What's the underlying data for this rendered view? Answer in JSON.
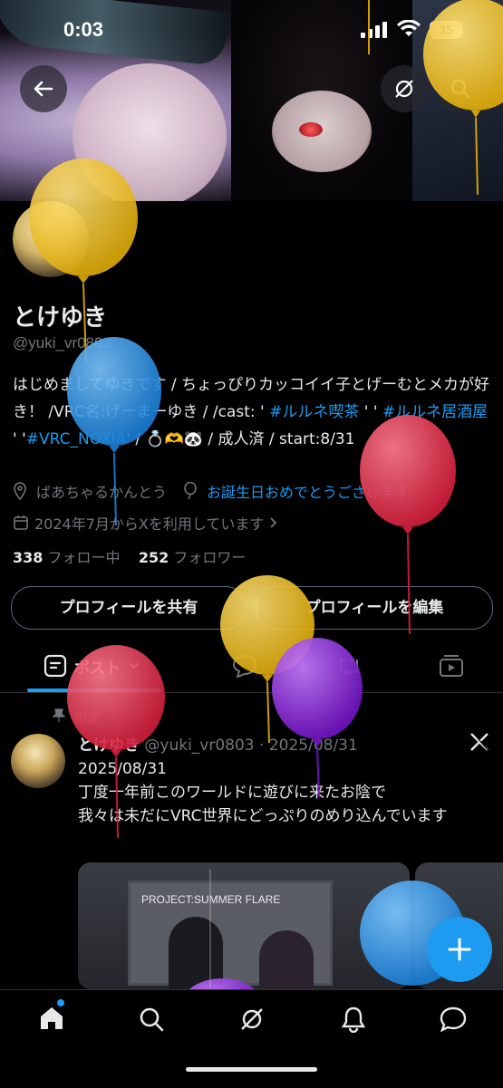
{
  "status_bar": {
    "time": "0:03",
    "battery": "35"
  },
  "profile": {
    "name": "とけゆき",
    "handle": "@yuki_vr0803",
    "bio": {
      "part1": "はじめましてゆきです / ちょっぴりカッコイイ子とげーむとメカが好き！ /VRC名:げーまーゆき / /cast: ' ",
      "hashtag1": "#ルルネ喫茶",
      "part2": " ' ' ",
      "hashtag2": "#ルルネ居酒屋",
      "part3": " ' '",
      "hashtag3": "#VRC_NOXIA",
      "part4": "' / 💍🫶🐼 / 成人済 / start:8/31"
    },
    "location": "ばあちゃるかんとう",
    "birthday_text": "お誕生日おめでとうございます。",
    "joined": "2024年7月からXを利用しています",
    "following_count": "338",
    "following_label": "フォロー中",
    "followers_count": "252",
    "followers_label": "フォロワー",
    "share_button": "プロフィールを共有",
    "edit_button": "プロフィールを編集"
  },
  "tabs": {
    "posts_label": "ポスト"
  },
  "pinned_post": {
    "pinned_label": "固定",
    "author": "とけゆき",
    "handle_date": "@yuki_vr0803 · 2025/08/31",
    "line1": "2025/08/31",
    "line2": "丁度一年前このワールドに遊びに来たお陰で",
    "line3": "我々は未だにVRC世界にどっぷりのめり込んでいます",
    "media_label": "PROJECT:SUMMER FLARE"
  },
  "colors": {
    "accent": "#1d9bf0",
    "balloon_yellow": "#f2c21b",
    "balloon_blue": "#2f9be8",
    "balloon_red": "#e8364f",
    "balloon_purple": "#8e2bd6"
  }
}
